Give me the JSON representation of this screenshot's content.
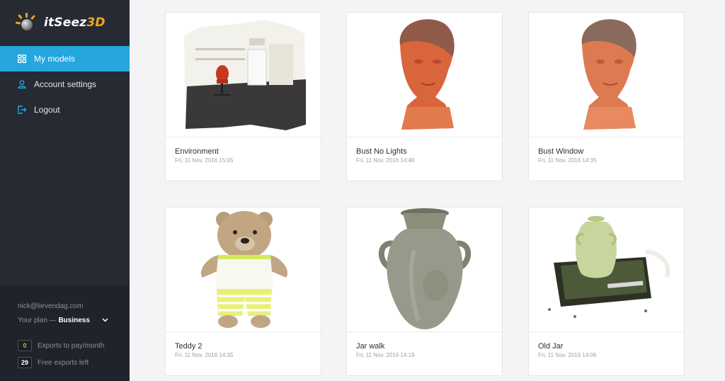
{
  "brand": {
    "name_part1": "itSeez",
    "name_part2": "3D",
    "accent": "#f1a71b"
  },
  "sidebar": {
    "items": [
      {
        "label": "My models",
        "icon": "grid-icon",
        "active": true
      },
      {
        "label": "Account settings",
        "icon": "user-icon",
        "active": false
      },
      {
        "label": "Logout",
        "icon": "logout-icon",
        "active": false
      }
    ],
    "active_color": "#25a6dd"
  },
  "account": {
    "email": "nick@lievendag.com",
    "plan_label": "Your plan —",
    "plan_name": "Business",
    "exports_to_pay_count": "0",
    "exports_to_pay_label": "Exports to pay/month",
    "free_exports_count": "29",
    "free_exports_label": "Free exports left"
  },
  "models": [
    {
      "title": "Environment",
      "date": "Fri, 11 Nov. 2016 15:05",
      "thumb": "office-room-scan"
    },
    {
      "title": "Bust No Lights",
      "date": "Fri, 11 Nov. 2016 14:48",
      "thumb": "terracotta-bust"
    },
    {
      "title": "Bust Window",
      "date": "Fri, 11 Nov. 2016 14:35",
      "thumb": "terracotta-bust"
    },
    {
      "title": "Teddy 2",
      "date": "Fri, 11 Nov. 2016 14:35",
      "thumb": "knitted-teddy-bear"
    },
    {
      "title": "Jar walk",
      "date": "Fri, 11 Nov. 2016 14:19",
      "thumb": "stone-jar"
    },
    {
      "title": "Old Jar",
      "date": "Fri, 11 Nov. 2016 14:06",
      "thumb": "small-jar-on-book"
    }
  ]
}
